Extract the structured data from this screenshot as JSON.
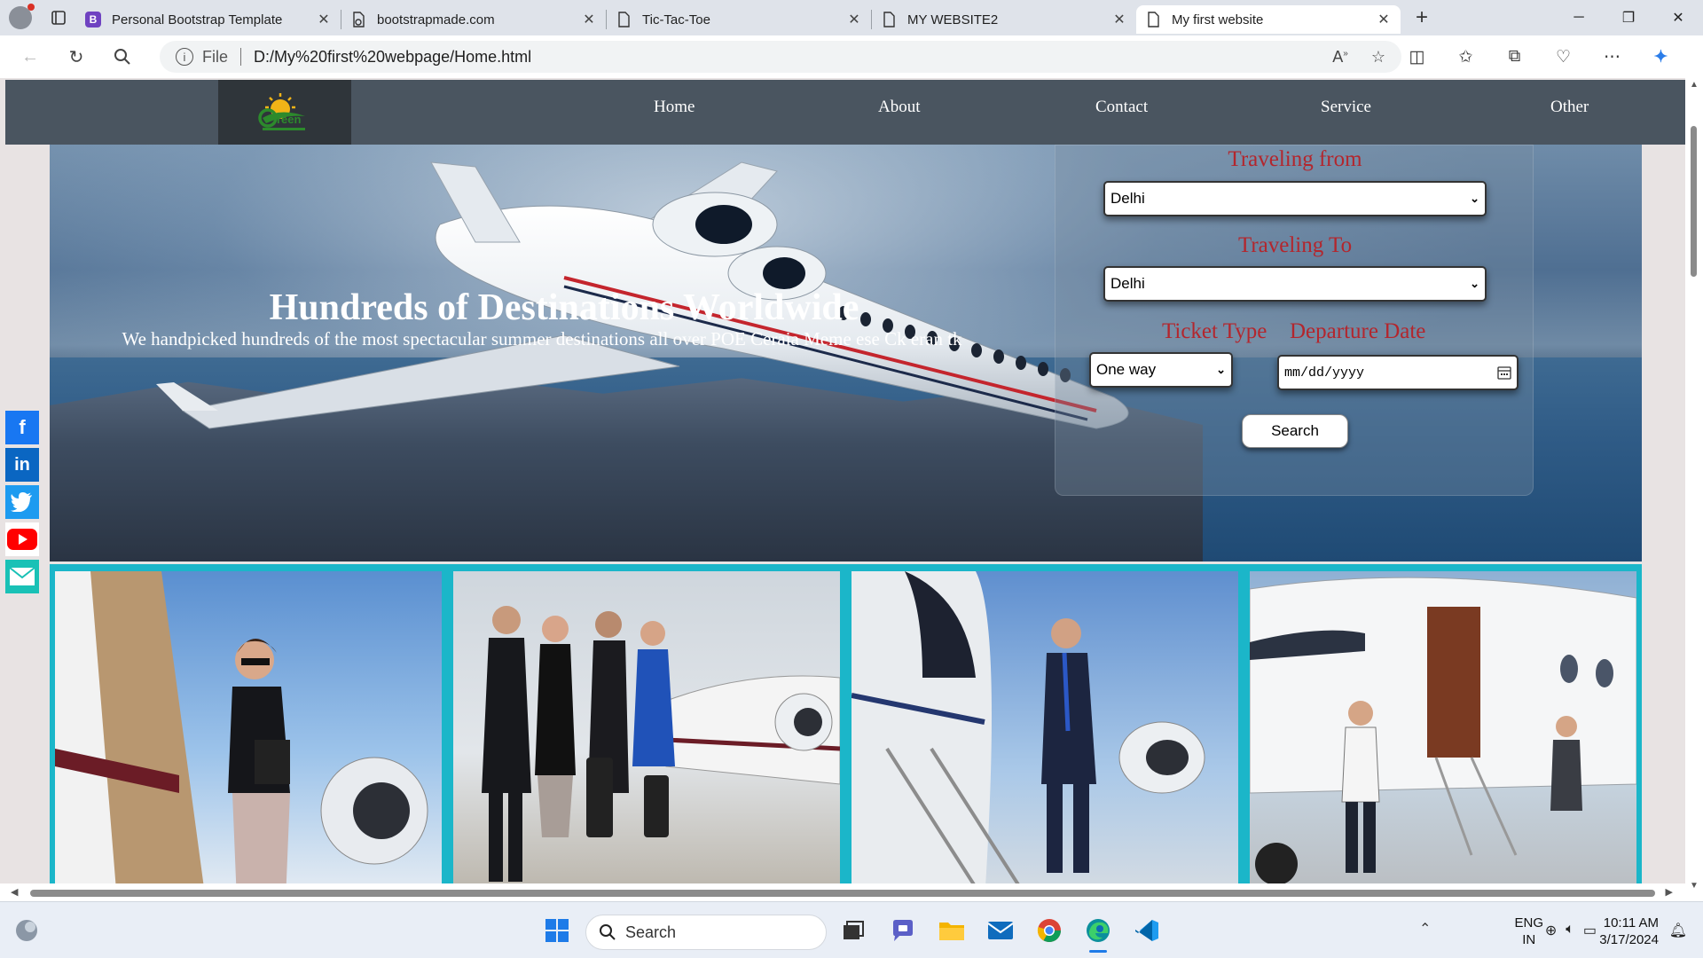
{
  "browser": {
    "tabs": [
      {
        "title": "Personal Bootstrap Template",
        "favicon": "bootstrap-icon",
        "active": false
      },
      {
        "title": "bootstrapmade.com",
        "favicon": "page-loading-icon",
        "active": false
      },
      {
        "title": "Tic-Tac-Toe",
        "favicon": "page-icon",
        "active": false
      },
      {
        "title": "MY WEBSITE2",
        "favicon": "page-icon",
        "active": false
      },
      {
        "title": "My first website",
        "favicon": "page-icon",
        "active": true
      }
    ],
    "address": {
      "scheme_label": "File",
      "url": "D:/My%20first%20webpage/Home.html"
    }
  },
  "site": {
    "logo_text": "reen",
    "nav": [
      "Home",
      "About",
      "Contact",
      "Service",
      "Other"
    ],
    "hero": {
      "title": "Hundreds of Destinations Worldwide",
      "subtitle": "We handpicked hundreds of the most spectacular summer destinations all over POE Ceraia Meme ese Ck eran tk"
    },
    "booking": {
      "from_label": "Traveling from",
      "from_value": "Delhi",
      "to_label": "Traveling To",
      "to_value": "Delhi",
      "ticket_label": "Ticket Type",
      "ticket_value": "One way",
      "date_label": "Departure Date",
      "date_placeholder": "mm/dd/yyyy",
      "search_label": "Search"
    },
    "social": [
      "facebook-icon",
      "linkedin-icon",
      "twitter-icon",
      "youtube-icon",
      "email-icon"
    ],
    "gallery_colors": {
      "border": "#1bb6c9"
    }
  },
  "taskbar": {
    "search_placeholder": "Search",
    "lang_top": "ENG",
    "lang_bottom": "IN",
    "time": "10:11 AM",
    "date": "3/17/2024"
  }
}
